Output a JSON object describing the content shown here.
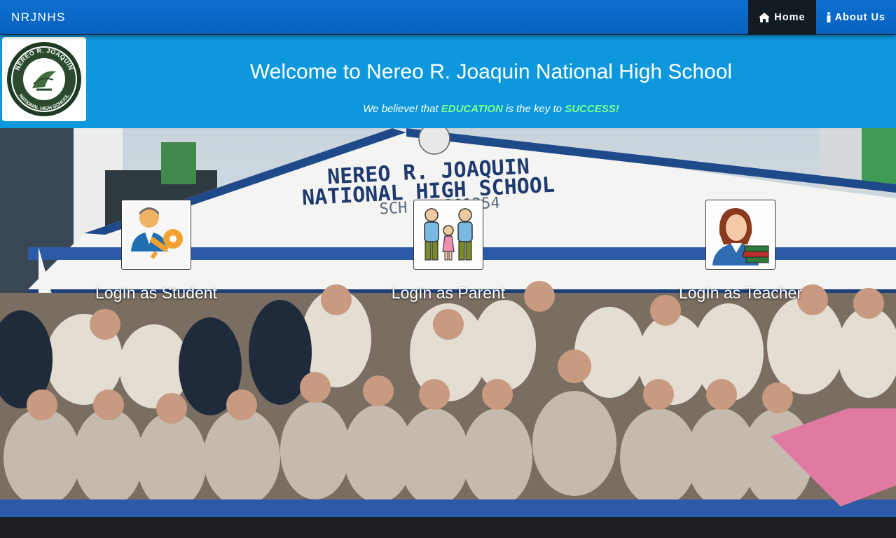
{
  "navbar": {
    "brand": "NRJNHS",
    "items": [
      {
        "label": "Home",
        "icon": "home-icon",
        "active": true
      },
      {
        "label": "About Us",
        "icon": "info-icon",
        "active": false
      }
    ]
  },
  "banner": {
    "logo_text_top": "NEREO R. JOAQUIN",
    "logo_text_bottom": "NATIONAL HIGH SCHOOL",
    "welcome": "Welcome to Nereo R. Joaquin National High School",
    "tagline": {
      "part1": "We believe! that ",
      "highlight1": "EDUCATION",
      "part2": " is the key to ",
      "highlight2": "SUCCESS!"
    }
  },
  "hero": {
    "building_sign_line1": "NEREO R. JOAQUIN",
    "building_sign_line2": "NATIONAL HIGH SCHOOL",
    "building_sign_line3": "SCH ID 301254"
  },
  "login_options": [
    {
      "label": "LogIn as Student",
      "icon": "student-key-icon"
    },
    {
      "label": "LogIn as Parent",
      "icon": "parents-family-icon"
    },
    {
      "label": "LogIn as Teacher",
      "icon": "teacher-books-icon"
    }
  ],
  "colors": {
    "navbar": "#0b6fd0",
    "banner": "#0d98dd",
    "active_nav": "#121a22",
    "tagline_highlight": "#7fff8f"
  }
}
